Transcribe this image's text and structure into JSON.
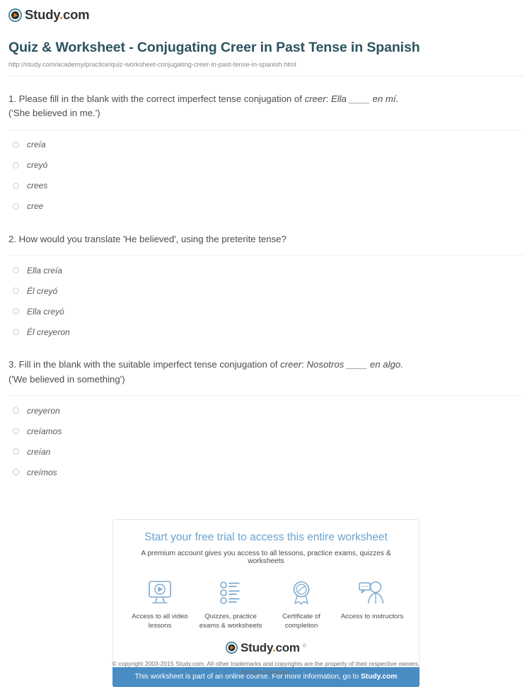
{
  "brand": {
    "name": "Study.com",
    "name_main": "Study",
    "name_dot": ".",
    "name_tld": "com",
    "logo_icon": "play-circle-icon",
    "ring_color": "#2b7b8c",
    "play_color": "#e8821e",
    "trademark": "®"
  },
  "header": {
    "title": "Quiz & Worksheet - Conjugating Creer in Past Tense in Spanish",
    "url": "http://study.com/academy/practice/quiz-worksheet-conjugating-creer-in-past-tense-in-spanish.html",
    "title_color": "#2c5360"
  },
  "questions": [
    {
      "number": "1.",
      "stem_html": "1. Please fill in the blank with the correct imperfect tense conjugation of <i>creer</i>: <i>Ella ____ en mí.</i><br>('She believed in me.')",
      "stem_plain": "1. Please fill in the blank with the correct imperfect tense conjugation of creer: Ella ____ en mí. ('She believed in me.')",
      "options": [
        "creía",
        "creyó",
        "crees",
        "cree"
      ]
    },
    {
      "number": "2.",
      "stem_html": "2. How would you translate 'He believed', using the preterite tense?",
      "stem_plain": "2. How would you translate 'He believed', using the preterite tense?",
      "options": [
        "Ella creía",
        "Él creyó",
        "Ella creyó",
        "Él creyeron"
      ]
    },
    {
      "number": "3.",
      "stem_html": "3. Fill in the blank with the suitable imperfect tense conjugation of <i>creer</i>: <i>Nosotros ____ en algo.</i><br>('We believed in something')",
      "stem_plain": "3. Fill in the blank with the suitable imperfect tense conjugation of creer: Nosotros ____ en algo. ('We believed in something')",
      "options": [
        "creyeron",
        "creíamos",
        "creían",
        "creímos"
      ]
    }
  ],
  "promo": {
    "headline": "Start your free trial to access this entire worksheet",
    "headline_color": "#6ba3cf",
    "subtitle": "A premium account gives you access to all lessons, practice exams, quizzes & worksheets",
    "features": [
      {
        "icon": "monitor-play-icon",
        "label": "Access to all video lessons"
      },
      {
        "icon": "checklist-icon",
        "label": "Quizzes, practice exams & worksheets"
      },
      {
        "icon": "award-ribbon-icon",
        "label": "Certificate of completion"
      },
      {
        "icon": "instructor-chat-icon",
        "label": "Access to instructors"
      }
    ],
    "banner_text_before": "This worksheet is part of an online course. For more information, go to ",
    "banner_link": "Study.com",
    "banner_color": "#4a8dc4",
    "icon_color": "#7aa9d0"
  },
  "footer": {
    "copyright_line1": "© copyright 2003-2015 Study.com. All other trademarks and copyrights are the property of their respective owners.",
    "copyright_line2": "All rights reserved."
  }
}
